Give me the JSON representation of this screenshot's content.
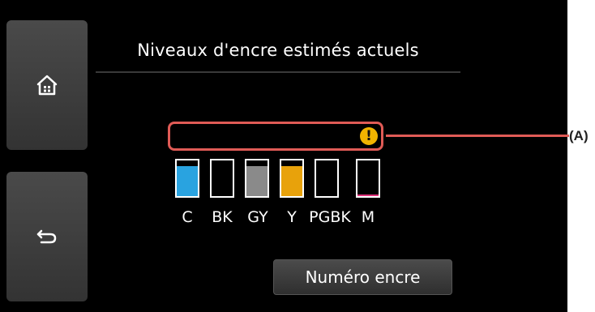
{
  "screen": {
    "title": "Niveaux d'encre estimés actuels"
  },
  "sidebar": {
    "home_icon": "home-icon",
    "back_icon": "back-arrow-icon"
  },
  "warning": {
    "icon": "warning-exclamation-icon",
    "symbol": "!",
    "color": "#f1b400",
    "box_color": "#e05b56"
  },
  "ink": {
    "tanks": [
      {
        "label": "C",
        "color": "#29a3e0",
        "level": 0.85
      },
      {
        "label": "BK",
        "color": "#000000",
        "level": 0.0
      },
      {
        "label": "GY",
        "color": "#8a8a8a",
        "level": 0.85
      },
      {
        "label": "Y",
        "color": "#e8a20b",
        "level": 0.85
      },
      {
        "label": "PGBK",
        "color": "#000000",
        "level": 0.0
      },
      {
        "label": "M",
        "color": "#e0327a",
        "level": 0.05
      }
    ]
  },
  "buttons": {
    "ink_number": "Numéro encre"
  },
  "annotation": {
    "label": "(A)"
  }
}
